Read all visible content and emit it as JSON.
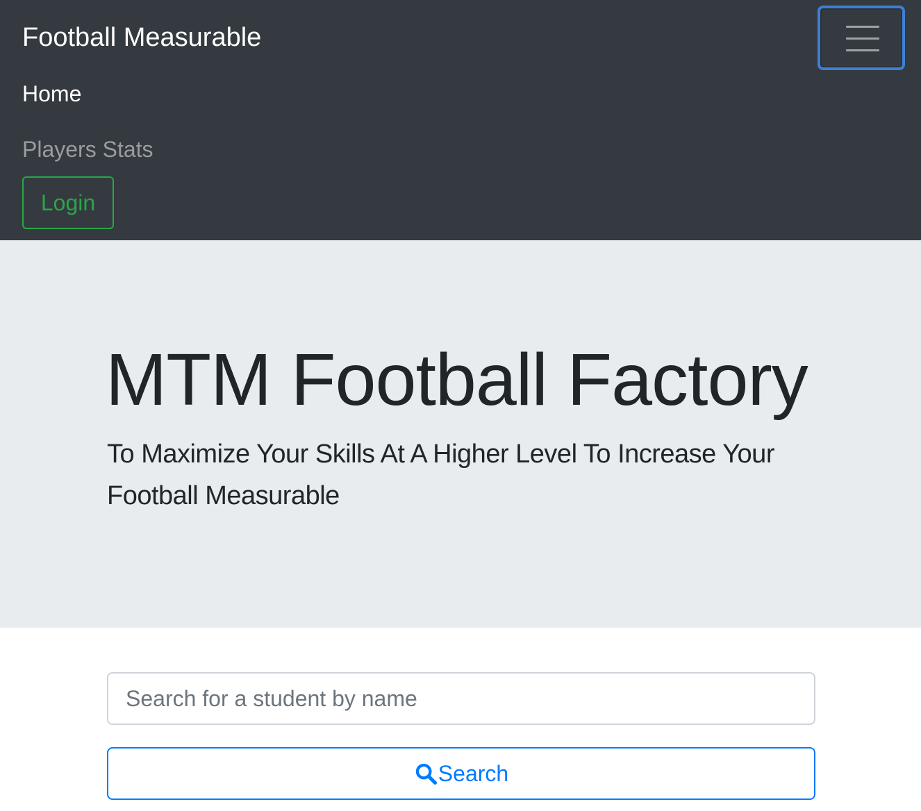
{
  "navbar": {
    "brand": "Football Measurable",
    "links": [
      {
        "label": "Home",
        "active": true
      },
      {
        "label": "Players Stats",
        "active": false
      }
    ],
    "login_label": "Login",
    "toggler_icon": "hamburger-icon"
  },
  "jumbotron": {
    "title": "MTM Football Factory",
    "lead": "To Maximize Your Skills At A Higher Level To Increase Your Football Measurable"
  },
  "search": {
    "placeholder": "Search for a student by name",
    "value": "",
    "button_label": "Search",
    "button_icon": "search-icon"
  },
  "colors": {
    "navbar_bg": "#343a40",
    "jumbotron_bg": "#e9ecef",
    "success": "#28a745",
    "primary": "#007bff"
  }
}
